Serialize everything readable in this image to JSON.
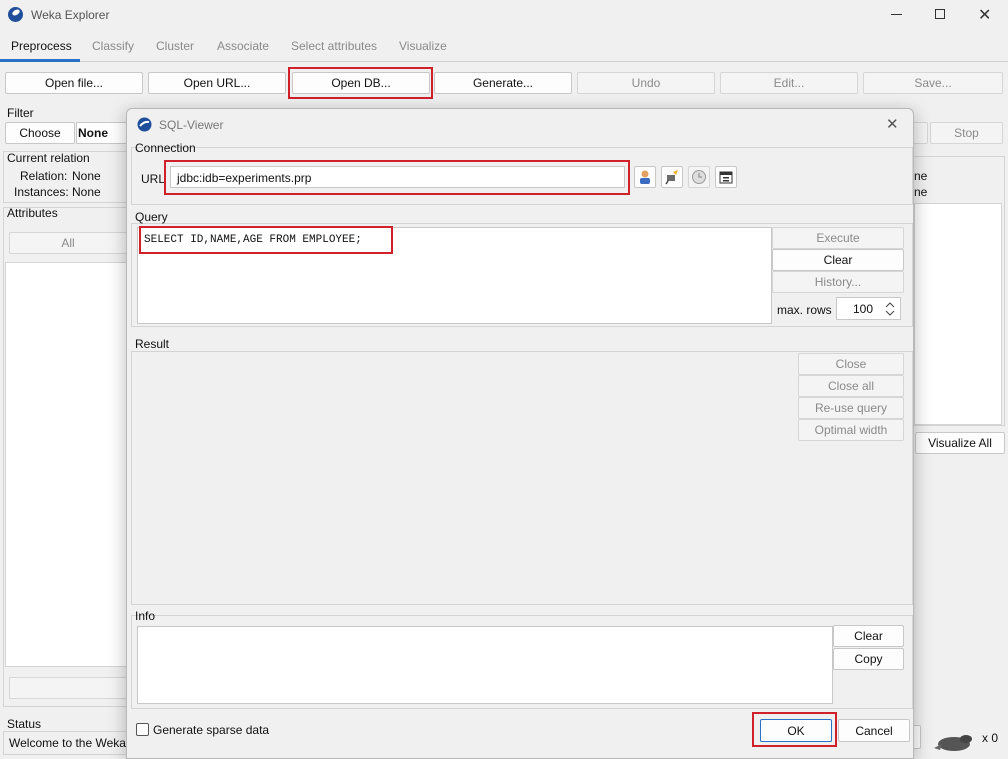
{
  "window": {
    "title": "Weka Explorer"
  },
  "tabs": [
    "Preprocess",
    "Classify",
    "Cluster",
    "Associate",
    "Select attributes",
    "Visualize"
  ],
  "toolbar": {
    "open_file": "Open file...",
    "open_url": "Open URL...",
    "open_db": "Open DB...",
    "generate": "Generate...",
    "undo": "Undo",
    "edit": "Edit...",
    "save": "Save..."
  },
  "filter": {
    "label": "Filter",
    "choose": "Choose",
    "value": "None",
    "stop": "Stop"
  },
  "relation": {
    "title": "Current relation",
    "relation_label": "Relation:",
    "relation_value": "None",
    "instances_label": "Instances:",
    "instances_value": "None",
    "right_1": "ne",
    "right_2": "ne"
  },
  "attributes": {
    "title": "Attributes",
    "all": "All"
  },
  "visualize_all": "Visualize All",
  "status": {
    "title": "Status",
    "text": "Welcome to the Weka",
    "x_count": "x 0"
  },
  "dialog": {
    "title": "SQL-Viewer",
    "connection": {
      "title": "Connection",
      "url_label": "URL",
      "url_value": "jdbc:idb=experiments.prp"
    },
    "query": {
      "title": "Query",
      "text": "SELECT ID,NAME,AGE FROM EMPLOYEE;",
      "execute": "Execute",
      "clear": "Clear",
      "history": "History...",
      "max_rows_label": "max. rows",
      "max_rows_value": "100"
    },
    "result": {
      "title": "Result",
      "close": "Close",
      "close_all": "Close all",
      "reuse": "Re-use query",
      "optimal": "Optimal width"
    },
    "info": {
      "title": "Info",
      "clear": "Clear",
      "copy": "Copy"
    },
    "sparse": "Generate sparse data",
    "ok": "OK",
    "cancel": "Cancel"
  }
}
